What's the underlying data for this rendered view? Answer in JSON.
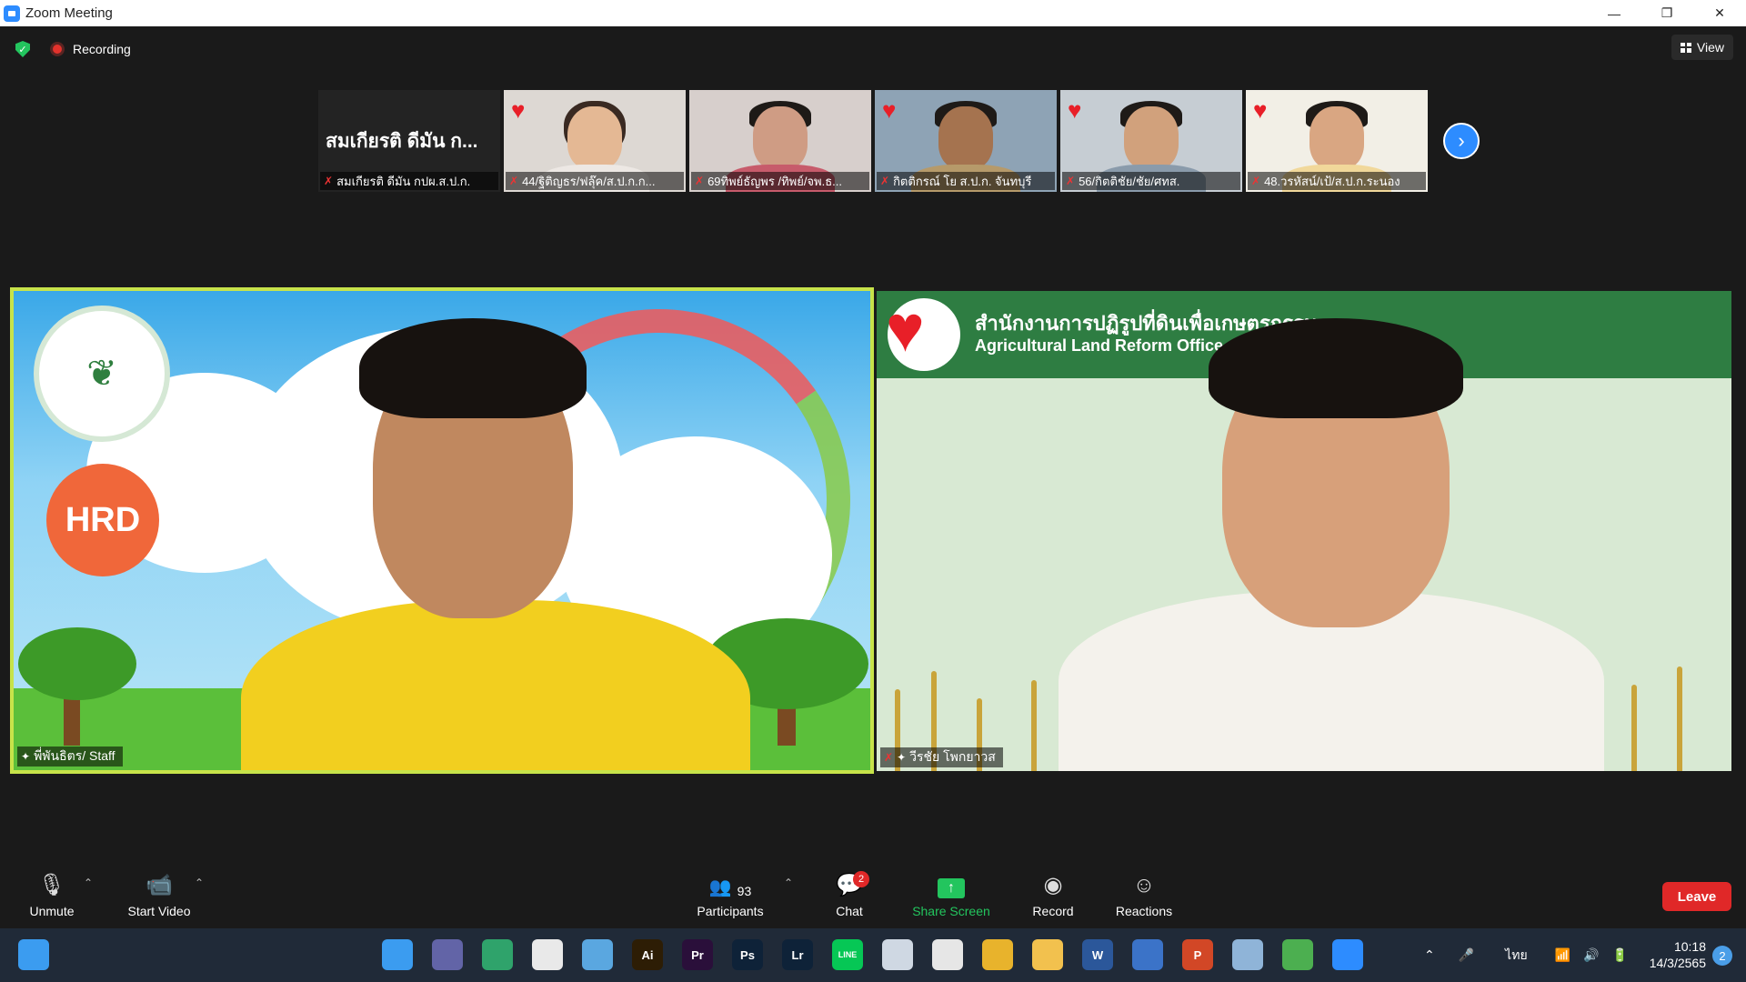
{
  "window": {
    "title": "Zoom Meeting",
    "controls": {
      "minimize": "—",
      "restore": "❐",
      "close": "✕"
    }
  },
  "topbar": {
    "recording_label": "Recording",
    "view_label": "View"
  },
  "thumbnails": [
    {
      "display_name": "สมเกียรติ ดีมัน ก...",
      "name": "สมเกียรติ ดีมัน กปผ.ส.ป.ก."
    },
    {
      "name": "44/ฐิติญธร/ฟลุ๊ค/ส.ป.ก.ก..."
    },
    {
      "name": "69ทิพย์ธัญพร /ทิพย์/จพ.ธ..."
    },
    {
      "name": "กิตติกรณ์ โย ส.ป.ก. จันทบุรี"
    },
    {
      "name": "56/กิตติชัย/ชัย/ศทส."
    },
    {
      "name": "48.วรหัสน์/เป้/ส.ป.ก.ระนอง"
    }
  ],
  "main_tiles": [
    {
      "name": "พี่พันธิตร/ Staff",
      "logo_text": "HRD"
    },
    {
      "name": "วีรชัย โพกยาวส",
      "banner_thai": "สำนักงานการปฏิรูปที่ดินเพื่อเกษตรกรรม",
      "banner_english": "Agricultural Land Reform Office"
    }
  ],
  "toolbar": {
    "unmute": "Unmute",
    "start_video": "Start Video",
    "participants": "Participants",
    "participants_count": "93",
    "chat": "Chat",
    "chat_badge": "2",
    "share_screen": "Share Screen",
    "record": "Record",
    "reactions": "Reactions",
    "leave": "Leave"
  },
  "taskbar": {
    "apps": [
      {
        "icon": "windows-start-icon",
        "label": "",
        "color": "#3b9cf0"
      },
      {
        "icon": "teams-chat-icon",
        "label": "",
        "color": "#6264a7"
      },
      {
        "icon": "notes-icon",
        "label": "",
        "color": "#2fa36b"
      },
      {
        "icon": "store-icon",
        "label": "",
        "color": "#e9e9e9"
      },
      {
        "icon": "photos-icon",
        "label": "",
        "color": "#5aa7e0"
      },
      {
        "icon": "illustrator-icon",
        "label": "Ai",
        "color": "#2d1d05"
      },
      {
        "icon": "premiere-icon",
        "label": "Pr",
        "color": "#2a0f3a"
      },
      {
        "icon": "photoshop-icon",
        "label": "Ps",
        "color": "#0e2238"
      },
      {
        "icon": "lightroom-icon",
        "label": "Lr",
        "color": "#0e2238"
      },
      {
        "icon": "line-icon",
        "label": "LINE",
        "color": "#06c755"
      },
      {
        "icon": "snipping-icon",
        "label": "",
        "color": "#cfd8e3"
      },
      {
        "icon": "screen-tool-icon",
        "label": "",
        "color": "#e6e6e6"
      },
      {
        "icon": "chrome-icon",
        "label": "",
        "color": "#e8b32c"
      },
      {
        "icon": "folder-icon",
        "label": "",
        "color": "#f2c14e"
      },
      {
        "icon": "word-icon",
        "label": "W",
        "color": "#2b579a"
      },
      {
        "icon": "vpn-icon",
        "label": "",
        "color": "#3b73c8"
      },
      {
        "icon": "powerpoint-icon",
        "label": "P",
        "color": "#d24726"
      },
      {
        "icon": "monitor-icon",
        "label": "",
        "color": "#8fb4d8"
      },
      {
        "icon": "chrome-profile-icon",
        "label": "",
        "color": "#4caf50"
      },
      {
        "icon": "zoom-icon",
        "label": "",
        "color": "#2d8cff"
      }
    ],
    "tray": {
      "language": "ไทย"
    },
    "clock_time": "10:18",
    "clock_date": "14/3/2565",
    "notification_count": "2"
  }
}
